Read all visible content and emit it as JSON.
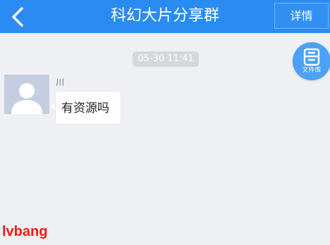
{
  "header": {
    "title": "科幻大片分享群",
    "details_label": "详情"
  },
  "chat": {
    "timestamp": "05-30 11:41",
    "messages": [
      {
        "sender": "川",
        "text": "有资源吗"
      }
    ]
  },
  "files_button": {
    "label": "文件库"
  },
  "watermark": {
    "text": "lvbang"
  },
  "colors": {
    "header_bg": "#2a8cf3",
    "chat_bg": "#eef0f4",
    "fab_bg": "#4aa1f6",
    "avatar_bg": "#c5cde0",
    "watermark": "#ff1515"
  },
  "icons": {
    "back": "chevron-left-icon",
    "files": "file-box-icon",
    "avatar": "default-user-icon"
  }
}
